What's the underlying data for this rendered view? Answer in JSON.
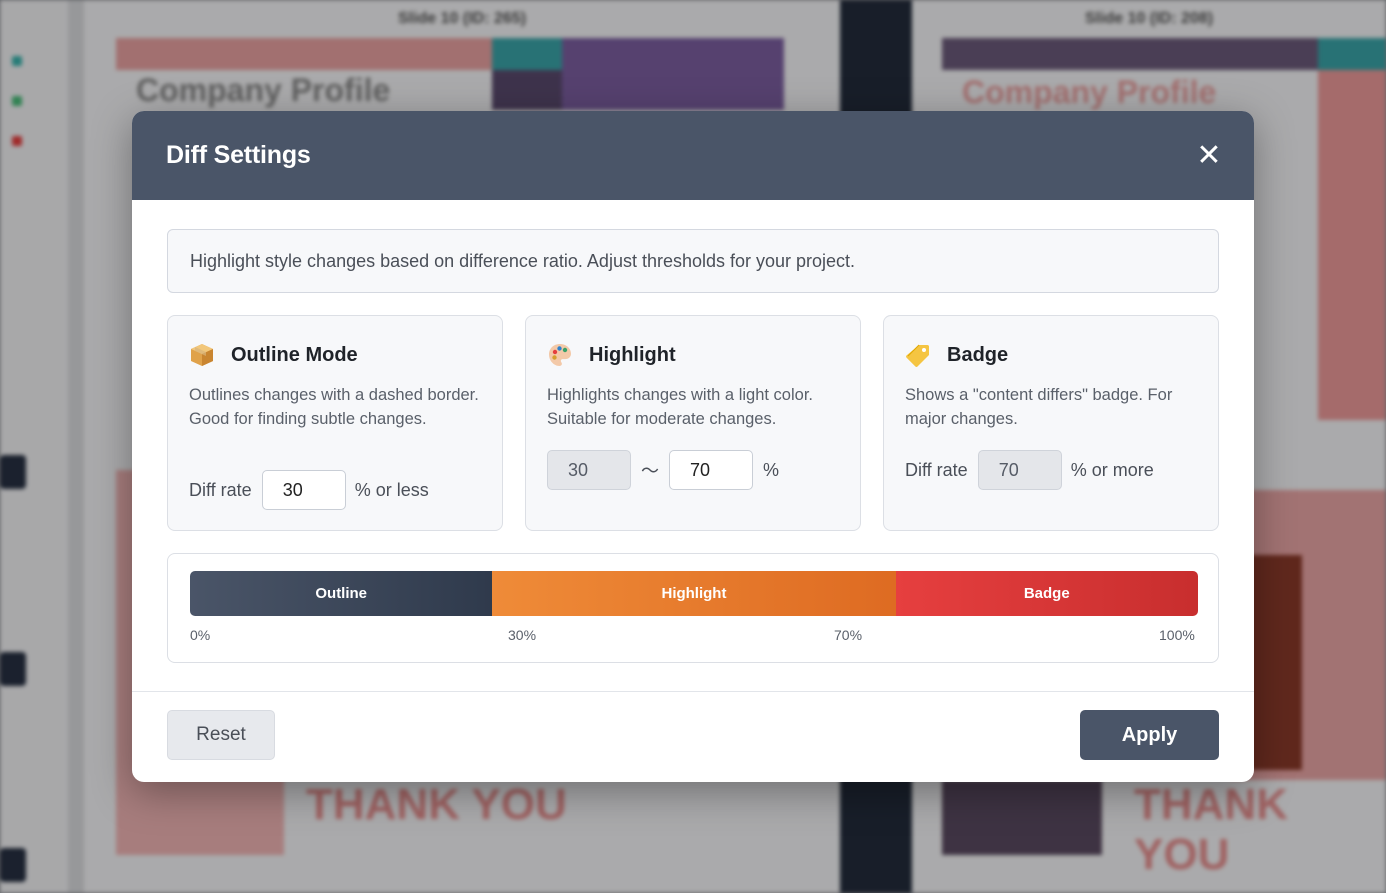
{
  "background": {
    "left_slide_caption": "Slide 10 (ID: 265)",
    "right_slide_caption": "Slide 10 (ID: 208)",
    "left_slide_title": "Company Profile",
    "right_slide_title": "Company Profile",
    "thank_you": "THANK YOU"
  },
  "modal": {
    "title": "Diff Settings",
    "close_symbol": "✕",
    "info": "Highlight style changes based on difference ratio. Adjust thresholds for your project."
  },
  "cards": {
    "outline": {
      "icon": "package-icon",
      "title": "Outline Mode",
      "desc": "Outlines changes with a dashed border. Good for finding subtle changes.",
      "rate_label": "Diff rate",
      "value": "30",
      "suffix": "% or less"
    },
    "highlight": {
      "icon": "palette-icon",
      "title": "Highlight",
      "desc": "Highlights changes with a light color. Suitable for moderate changes.",
      "min_value": "30",
      "separator": "～",
      "max_value": "70",
      "suffix": "%"
    },
    "badge": {
      "icon": "tag-icon",
      "title": "Badge",
      "desc": "Shows a \"content differs\" badge. For major changes.",
      "rate_label": "Diff rate",
      "value": "70",
      "suffix": "% or more"
    }
  },
  "scale": {
    "segments": [
      {
        "label": "Outline",
        "from": 0,
        "to": 30
      },
      {
        "label": "Highlight",
        "from": 30,
        "to": 70
      },
      {
        "label": "Badge",
        "from": 70,
        "to": 100
      }
    ],
    "ticks": [
      "0%",
      "30%",
      "70%",
      "100%"
    ]
  },
  "footer": {
    "reset_label": "Reset",
    "apply_label": "Apply"
  },
  "colors": {
    "header": "#4a5568",
    "outline": "#4a5568",
    "highlight": "#ed8936",
    "badge": "#e53e3e"
  }
}
